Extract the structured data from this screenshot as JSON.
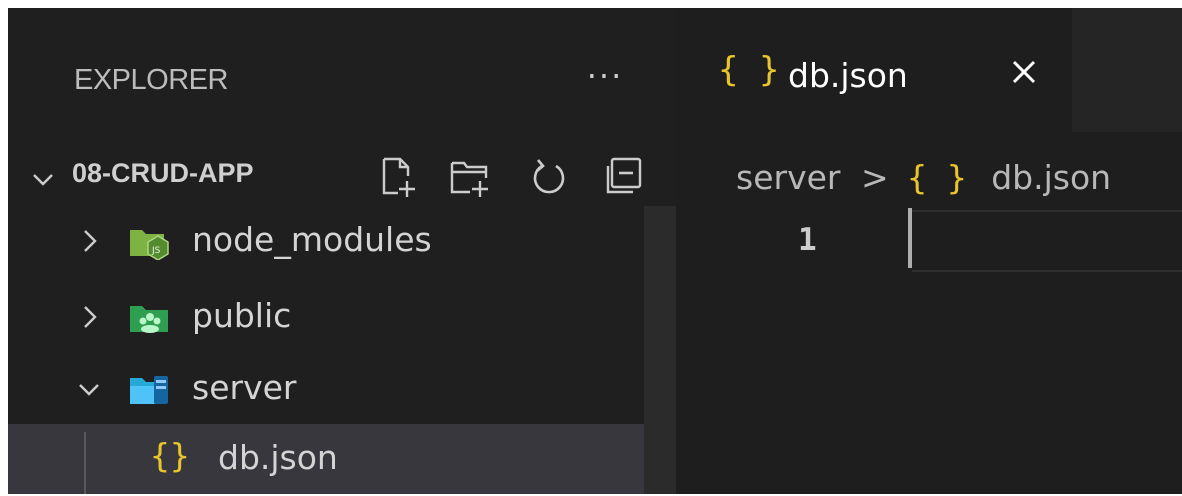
{
  "sidebar": {
    "title": "EXPLORER",
    "more_label": "···",
    "project": {
      "name": "08-CRUD-APP",
      "expanded": true,
      "actions": [
        "new-file-icon",
        "new-folder-icon",
        "refresh-icon",
        "collapse-all-icon"
      ]
    },
    "tree": [
      {
        "label": "node_modules",
        "type": "folder",
        "expanded": false,
        "icon": "node-folder-icon"
      },
      {
        "label": "public",
        "type": "folder",
        "expanded": false,
        "icon": "public-folder-icon"
      },
      {
        "label": "server",
        "type": "folder",
        "expanded": true,
        "icon": "server-folder-icon"
      },
      {
        "label": "db.json",
        "type": "file",
        "selected": true,
        "icon": "json-icon",
        "icon_glyph": "{}"
      }
    ]
  },
  "editor": {
    "tab": {
      "label": "db.json",
      "icon_glyph": "{ }"
    },
    "breadcrumb": {
      "folder": "server",
      "separator": ">",
      "icon_glyph": "{ }",
      "file": "db.json"
    },
    "line_numbers": [
      "1"
    ]
  },
  "colors": {
    "json_icon": "#e8c52c",
    "sidebar_bg": "#1f1f20",
    "selected_row": "#37373d",
    "editor_bg": "#1e1e1e"
  }
}
